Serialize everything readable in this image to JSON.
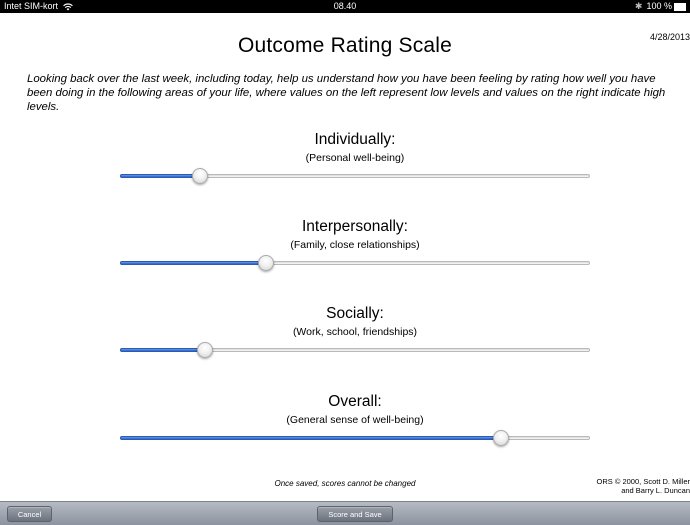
{
  "status_bar": {
    "carrier": "Intet SIM-kort",
    "time": "08.40",
    "battery": "100 %"
  },
  "header": {
    "title": "Outcome Rating Scale",
    "date": "4/28/2013"
  },
  "instructions": "Looking back over the last week, including today, help us understand how you have been feeling by rating how well you have been doing in the following areas of your life, where values on the left represent low levels and values on the right indicate high levels.",
  "scales": [
    {
      "label": "Individually:",
      "sub": "(Personal well-being)",
      "value": 0.17
    },
    {
      "label": "Interpersonally:",
      "sub": "(Family, close relationships)",
      "value": 0.31
    },
    {
      "label": "Socially:",
      "sub": "(Work, school, friendships)",
      "value": 0.18
    },
    {
      "label": "Overall:",
      "sub": "(General sense of well-being)",
      "value": 0.81
    }
  ],
  "footer": {
    "note": "Once saved, scores cannot be changed",
    "copyright_line1": "ORS © 2000, Scott D. Miller",
    "copyright_line2": "and Barry L. Duncan"
  },
  "toolbar": {
    "cancel_label": "Cancel",
    "save_label": "Score and Save"
  },
  "colors": {
    "slider_fill": "#2a62c9",
    "toolbar": "#8d939f"
  }
}
